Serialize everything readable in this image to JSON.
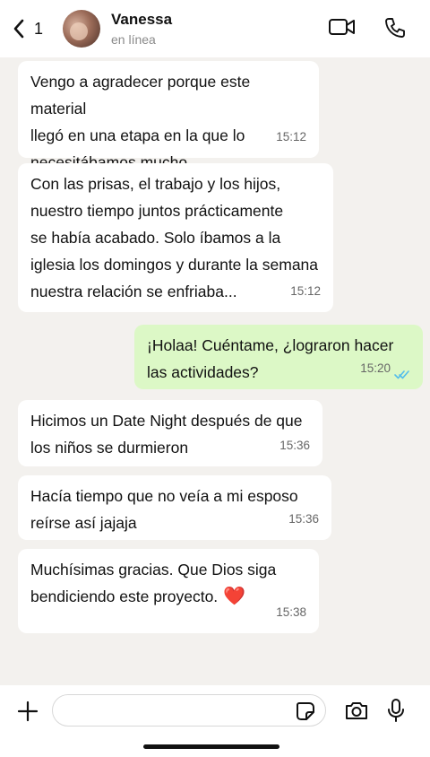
{
  "header": {
    "back_count": "1",
    "contact_name": "Vanessa",
    "contact_status": "en línea",
    "icons": [
      "chevron-left-icon",
      "video-call-icon",
      "phone-icon"
    ]
  },
  "messages": [
    {
      "direction": "in",
      "text": "Vengo a agradecer porque este material\nllegó en una etapa en la que lo\nnecesitábamos mucho.",
      "time": "15:12"
    },
    {
      "direction": "in",
      "text": "Con las prisas, el trabajo y los hijos,\nnuestro tiempo juntos prácticamente\nse había acabado. Solo íbamos a la\niglesia los domingos y durante la semana\nnuestra relación se enfriaba...",
      "time": "15:12"
    },
    {
      "direction": "out",
      "text": "¡Holaa! Cuéntame, ¿lograron hacer\nlas actividades?",
      "time": "15:20",
      "status": "read"
    },
    {
      "direction": "in",
      "text": "Hicimos un Date Night después de que\nlos niños se durmieron",
      "time": "15:36"
    },
    {
      "direction": "in",
      "text": "Hacía tiempo que no veía a mi esposo\nreírse así jajaja",
      "time": "15:36"
    },
    {
      "direction": "in",
      "text": "Muchísimas gracias. Que Dios siga\nbendiciendo este proyecto.",
      "emoji": "❤️",
      "time": "15:38"
    }
  ],
  "composer": {
    "input_value": "",
    "icons": [
      "plus-icon",
      "sticker-icon",
      "camera-icon",
      "microphone-icon"
    ]
  },
  "colors": {
    "chat_background": "#f3f1ee",
    "incoming_bubble": "#ffffff",
    "outgoing_bubble": "#dcf8c6",
    "read_ticks": "#53bdeb",
    "heart": "#e0262c"
  }
}
